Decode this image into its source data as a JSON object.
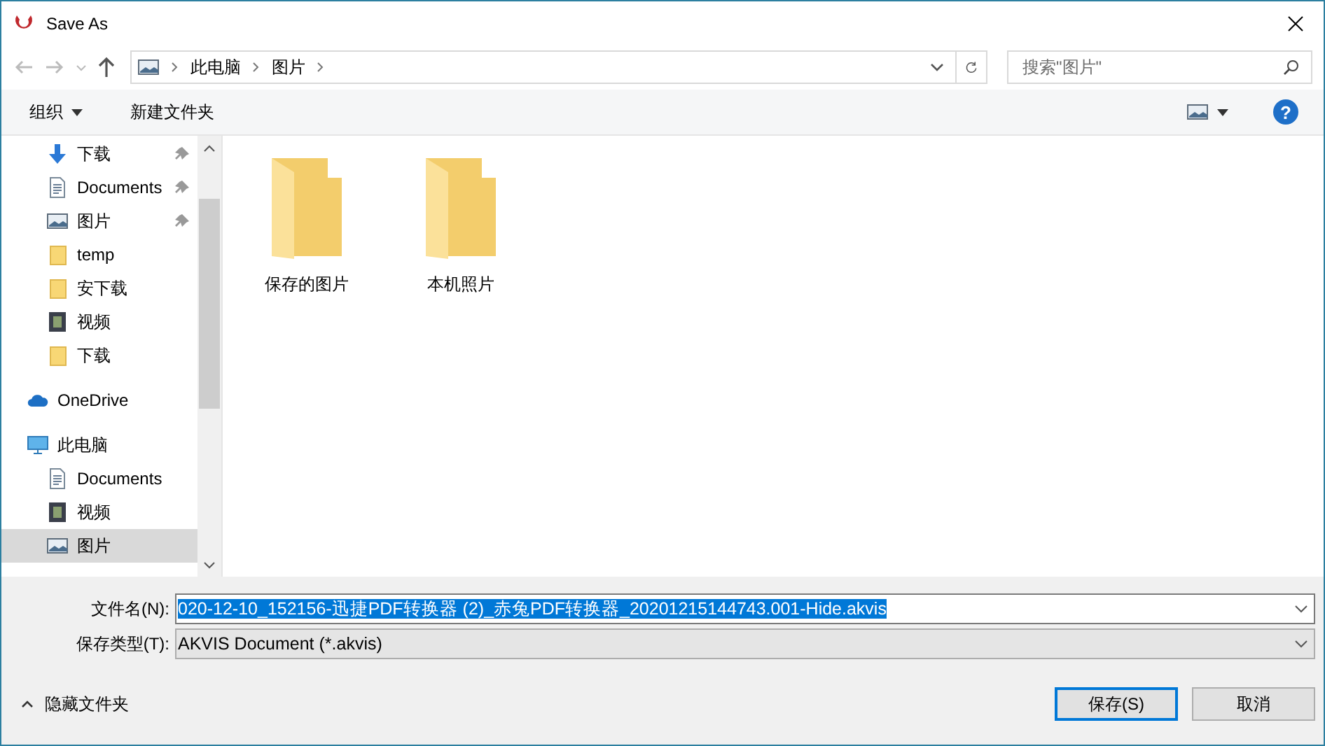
{
  "window": {
    "title": "Save As"
  },
  "address": {
    "crumbs": [
      "此电脑",
      "图片"
    ]
  },
  "search": {
    "placeholder": "搜索\"图片\""
  },
  "toolbar": {
    "organize": "组织",
    "new_folder": "新建文件夹",
    "help": "?"
  },
  "sidebar": {
    "groups": [
      {
        "items": [
          {
            "label": "下载",
            "kind": "download",
            "pinned": true,
            "selected": false
          },
          {
            "label": "Documents",
            "kind": "document",
            "pinned": true,
            "selected": false
          },
          {
            "label": "图片",
            "kind": "picture",
            "pinned": true,
            "selected": false
          },
          {
            "label": "temp",
            "kind": "folder",
            "pinned": false,
            "selected": false
          },
          {
            "label": "安下载",
            "kind": "folder",
            "pinned": false,
            "selected": false
          },
          {
            "label": "视频",
            "kind": "video",
            "pinned": false,
            "selected": false
          },
          {
            "label": "下载",
            "kind": "folder",
            "pinned": false,
            "selected": false
          }
        ]
      },
      {
        "items": [
          {
            "label": "OneDrive",
            "kind": "cloud",
            "pinned": false,
            "selected": false
          }
        ]
      },
      {
        "items": [
          {
            "label": "此电脑",
            "kind": "computer",
            "pinned": false,
            "selected": false,
            "children": [
              {
                "label": "Documents",
                "kind": "document",
                "pinned": false,
                "selected": false
              },
              {
                "label": "视频",
                "kind": "video",
                "pinned": false,
                "selected": false
              },
              {
                "label": "图片",
                "kind": "picture",
                "pinned": false,
                "selected": true
              }
            ]
          }
        ]
      }
    ]
  },
  "files": [
    {
      "name": "保存的图片"
    },
    {
      "name": "本机照片"
    }
  ],
  "form": {
    "filename_label": "文件名(N):",
    "filename": "020-12-10_152156-迅捷PDF转换器 (2)_赤兔PDF转换器_20201215144743.001-Hide.akvis",
    "filetype_label": "保存类型(T):",
    "filetype": "AKVIS Document (*.akvis)"
  },
  "hide_folders": "隐藏文件夹",
  "buttons": [
    {
      "label": "保存(S)",
      "kind": "primary"
    },
    {
      "label": "取消",
      "kind": "normal"
    }
  ]
}
